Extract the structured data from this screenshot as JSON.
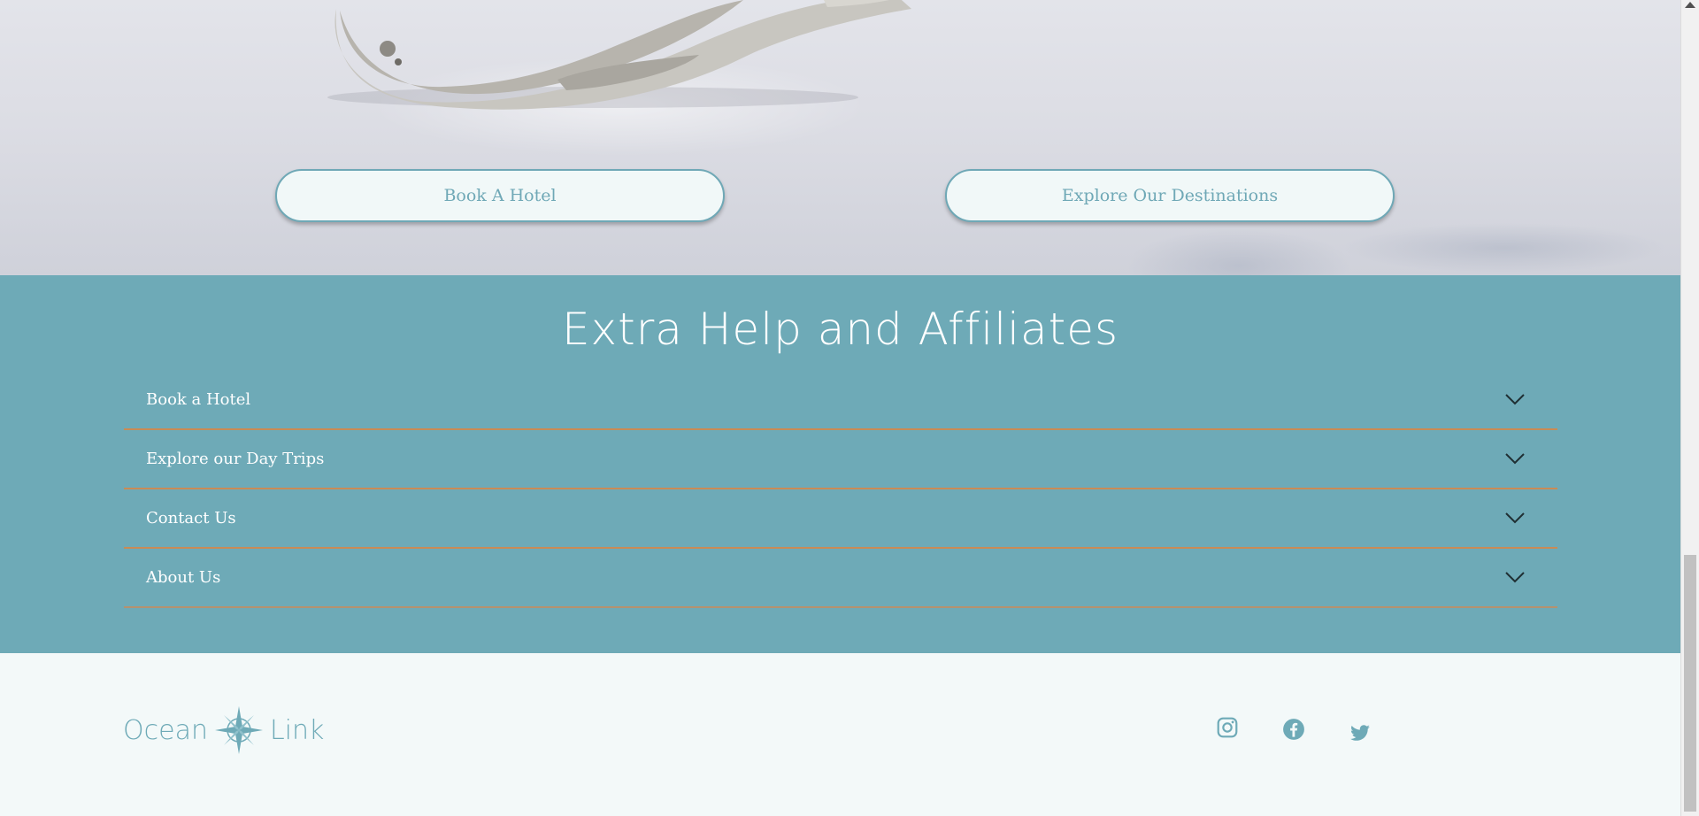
{
  "hero": {
    "book_hotel_label": "Book A Hotel",
    "explore_destinations_label": "Explore Our Destinations"
  },
  "help": {
    "title": "Extra Help and Affiliates",
    "items": [
      {
        "label": "Book a Hotel",
        "icon": "chevron-down-icon"
      },
      {
        "label": "Explore our Day Trips",
        "icon": "chevron-down-icon"
      },
      {
        "label": "Contact Us",
        "icon": "chevron-down-icon"
      },
      {
        "label": "About Us",
        "icon": "chevron-down-icon"
      }
    ]
  },
  "footer": {
    "logo_left": "Ocean",
    "logo_right": "Link",
    "logo_icon": "compass-star-icon",
    "social": [
      "instagram-icon",
      "facebook-icon",
      "twitter-icon"
    ]
  },
  "colors": {
    "teal": "#6eaab7",
    "divider": "#c98b55",
    "footer_bg": "#f3f9f9",
    "button_bg": "#f1f8f8"
  }
}
